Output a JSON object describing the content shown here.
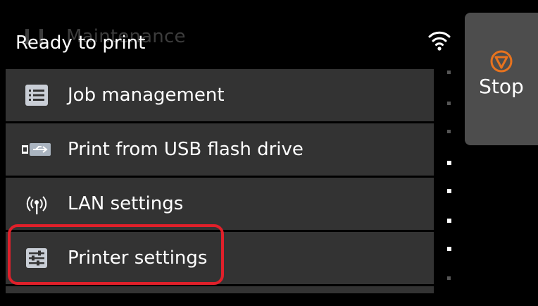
{
  "header": {
    "ghost_item_label": "Maintenance",
    "status_text": "Ready to print",
    "wifi_icon": "wifi-icon"
  },
  "menu": {
    "items": [
      {
        "label": "Job management",
        "icon": "list-icon"
      },
      {
        "label": "Print from USB flash drive",
        "icon": "usb-icon"
      },
      {
        "label": "LAN settings",
        "icon": "antenna-icon"
      },
      {
        "label": "Printer settings",
        "icon": "sliders-icon",
        "highlighted": true
      }
    ]
  },
  "stop": {
    "label": "Stop",
    "icon": "stop-icon",
    "accent": "#e8731e"
  },
  "colors": {
    "highlight": "#e0202a",
    "item_bg": "#333333",
    "stop_bg": "#4d4d4d"
  }
}
